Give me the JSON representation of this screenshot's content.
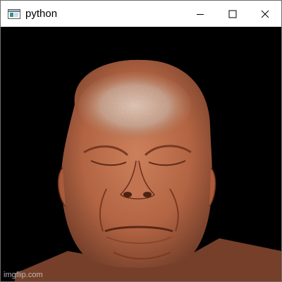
{
  "window": {
    "title": "python",
    "controls": {
      "minimize_icon": "minimize-icon",
      "maximize_icon": "maximize-icon",
      "close_icon": "close-icon"
    }
  },
  "viewport": {
    "content": "volume-rendered-head",
    "background_color": "#000000",
    "render_color": "#c8704a",
    "highlight_color": "#e8d8cc"
  },
  "watermark": {
    "text": "imgflip.com"
  }
}
